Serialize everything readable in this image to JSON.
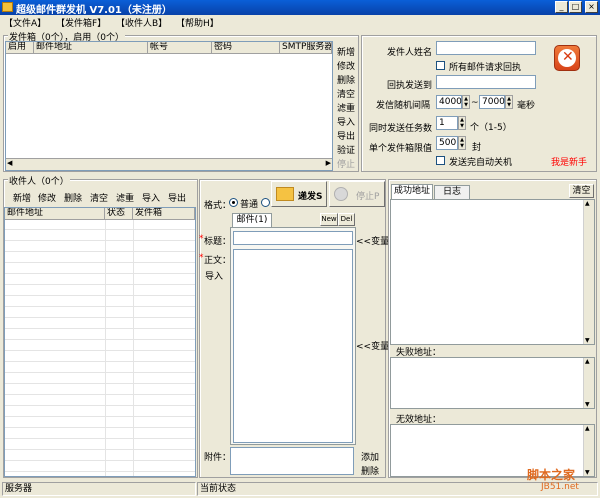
{
  "window": {
    "title": "超级邮件群发机 V7.01（未注册）",
    "min": "_",
    "max": "□",
    "close": "×"
  },
  "menu": [
    "【文件A】",
    "【发件箱F】",
    "【收件人B】",
    "【帮助H】"
  ],
  "senders": {
    "legend": "发件箱（0个），启用（0个）",
    "columns": [
      "启用",
      "邮件地址",
      "帐号",
      "密码",
      "SMTP服务器"
    ],
    "actions": [
      "新增",
      "修改",
      "删除",
      "清空",
      "滤重",
      "导入",
      "导出",
      "验证",
      "停止"
    ]
  },
  "settings": {
    "sender_name_label": "发件人姓名",
    "sender_name_value": "",
    "all_receipt_label": "所有邮件请求回执",
    "reply_to_label": "回执发送到",
    "reply_to_value": "",
    "interval_label": "发信随机间隔",
    "interval_min": "4000",
    "interval_sep": "~",
    "interval_max": "7000",
    "interval_unit": "毫秒",
    "tasks_label": "同时发送任务数",
    "tasks_value": "1",
    "tasks_hint": "个（1-5）",
    "limit_label": "单个发件箱限值",
    "limit_value": "500",
    "limit_unit": "封",
    "shutdown_label": "发送完自动关机",
    "newbie_link": "我是新手"
  },
  "recipients": {
    "legend": "收件人（0个）",
    "toolbar": [
      "新增",
      "修改",
      "删除",
      "清空",
      "滤重",
      "导入",
      "导出"
    ],
    "columns": [
      "邮件地址",
      "状态",
      "发件箱"
    ]
  },
  "composer": {
    "format_label": "格式：",
    "format_normal": "普通",
    "send_button": "递发S",
    "stop_button": "停止P",
    "tab_mail": "邮件(1)",
    "new_btn": "New",
    "del_btn": "Del",
    "subject_label": "标题：",
    "body_label": "正文：",
    "import_label": "导入",
    "var1": "<<变量",
    "var2": "<<变量",
    "attach_label": "附件：",
    "attach_add": "添加",
    "attach_del": "删除",
    "star": "*"
  },
  "log": {
    "tab_success": "成功地址",
    "tab_log": "日志",
    "clear": "清空",
    "failed_label": "失败地址：",
    "invalid_label": "无效地址："
  },
  "status": {
    "server": "服务器",
    "current": "当前状态"
  },
  "watermark": {
    "line1": "脚本之家",
    "line2": "JB51.net"
  },
  "colors": {
    "titlebar": "#0841a8",
    "close_button": "#e85a1e",
    "link_red": "#ff0000"
  }
}
